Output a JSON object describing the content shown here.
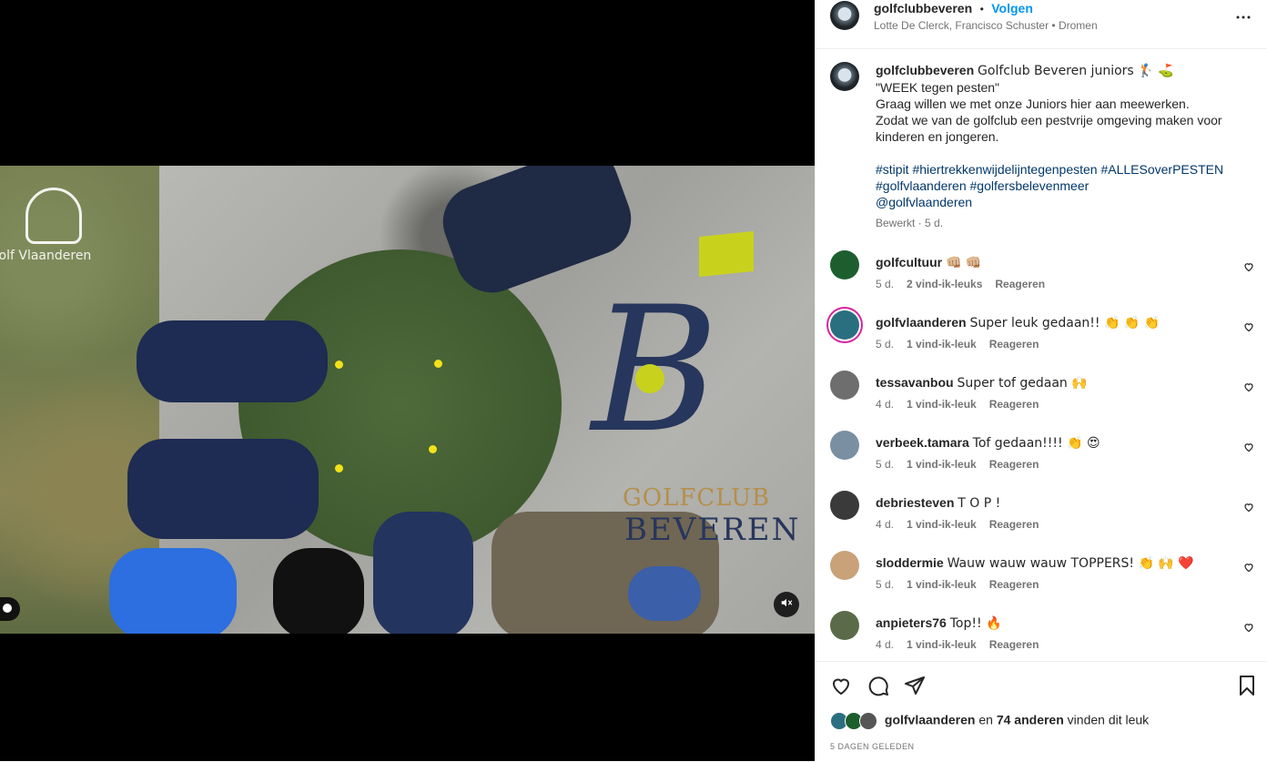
{
  "header": {
    "username": "golfclubbeveren",
    "separator": "•",
    "follow_label": "Volgen",
    "subtitle": "Lotte De Clerck, Francisco Schuster • Dromen",
    "more_icon": "more-horizontal-icon"
  },
  "media": {
    "watermark_logo_text": "Golf Vlaanderen",
    "club_line1": "GOLFCLUB",
    "club_line2": "BEVEREN"
  },
  "caption": {
    "username": "golfclubbeveren",
    "line1": "Golfclub Beveren juniors 🏌️ ⛳",
    "line2": "\"WEEK tegen pesten\"",
    "line3": "Graag willen we met onze Juniors hier aan meewerken.",
    "line4": "Zodat we van de golfclub een pestvrije omgeving maken voor kinderen en jongeren.",
    "hashtags_line1": "#stipit #hiertrekkenwijdelijntegenpesten #ALLESoverPESTEN",
    "hashtags_line2": "#golfvlaanderen #golfersbelevenmeer",
    "mention": "@golfvlaanderen",
    "edited": "Bewerkt · 5 d."
  },
  "comments": [
    {
      "username": "golfcultuur",
      "text": "👊🏼 👊🏼",
      "time": "5 d.",
      "likes": "2 vind-ik-leuks",
      "reply": "Reageren",
      "avatar_color": "#1d5e2e"
    },
    {
      "username": "golfvlaanderen",
      "text": "Super leuk gedaan!! 👏 👏 👏",
      "time": "5 d.",
      "likes": "1 vind-ik-leuk",
      "reply": "Reageren",
      "avatar_color": "#2a6f80"
    },
    {
      "username": "tessavanbou",
      "text": "Super tof gedaan 🙌",
      "time": "4 d.",
      "likes": "1 vind-ik-leuk",
      "reply": "Reageren",
      "avatar_color": "#6e6e6e"
    },
    {
      "username": "verbeek.tamara",
      "text": "Tof gedaan!!!! 👏 😍",
      "time": "5 d.",
      "likes": "1 vind-ik-leuk",
      "reply": "Reageren",
      "avatar_color": "#7b8fa3"
    },
    {
      "username": "debriesteven",
      "text": "T O P !",
      "time": "4 d.",
      "likes": "1 vind-ik-leuk",
      "reply": "Reageren",
      "avatar_color": "#3a3a3a"
    },
    {
      "username": "sloddermie",
      "text": "Wauw wauw wauw TOPPERS! 👏 🙌 ❤️",
      "time": "5 d.",
      "likes": "1 vind-ik-leuk",
      "reply": "Reageren",
      "avatar_color": "#c9a27a"
    },
    {
      "username": "anpieters76",
      "text": "Top!! 🔥",
      "time": "4 d.",
      "likes": "1 vind-ik-leuk",
      "reply": "Reageren",
      "avatar_color": "#5b6b4a"
    }
  ],
  "actions": {
    "like_icon": "heart-icon",
    "comment_icon": "comment-icon",
    "share_icon": "send-icon",
    "save_icon": "bookmark-icon",
    "likes_user": "golfvlaanderen",
    "likes_middle": "en",
    "likes_count": "74 anderen",
    "likes_suffix": "vinden dit leuk",
    "posted_ago": "5 DAGEN GELEDEN"
  }
}
